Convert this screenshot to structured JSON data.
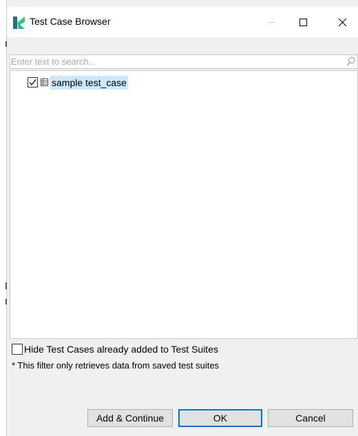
{
  "window": {
    "title": "Test Case Browser",
    "app_icon": "katalon-logo-icon",
    "controls": [
      "minimize-icon",
      "maximize-icon",
      "close-icon"
    ]
  },
  "search": {
    "placeholder": "Enter text to search...",
    "value": "",
    "icon": "search-icon"
  },
  "tree": {
    "items": [
      {
        "label": "sample test_case",
        "checked": true,
        "icon": "test-case-icon",
        "selected": true
      }
    ]
  },
  "filter": {
    "checkbox_label": "Hide Test Cases already added to Test Suites",
    "checked": false,
    "note": "* This filter only retrieves data from saved test suites"
  },
  "buttons": {
    "add_continue": "Add & Continue",
    "ok": "OK",
    "cancel": "Cancel"
  },
  "colors": {
    "selection": "#cce8ff",
    "focus_border": "#0078d7",
    "dialog_bg": "#f0f0f0"
  }
}
